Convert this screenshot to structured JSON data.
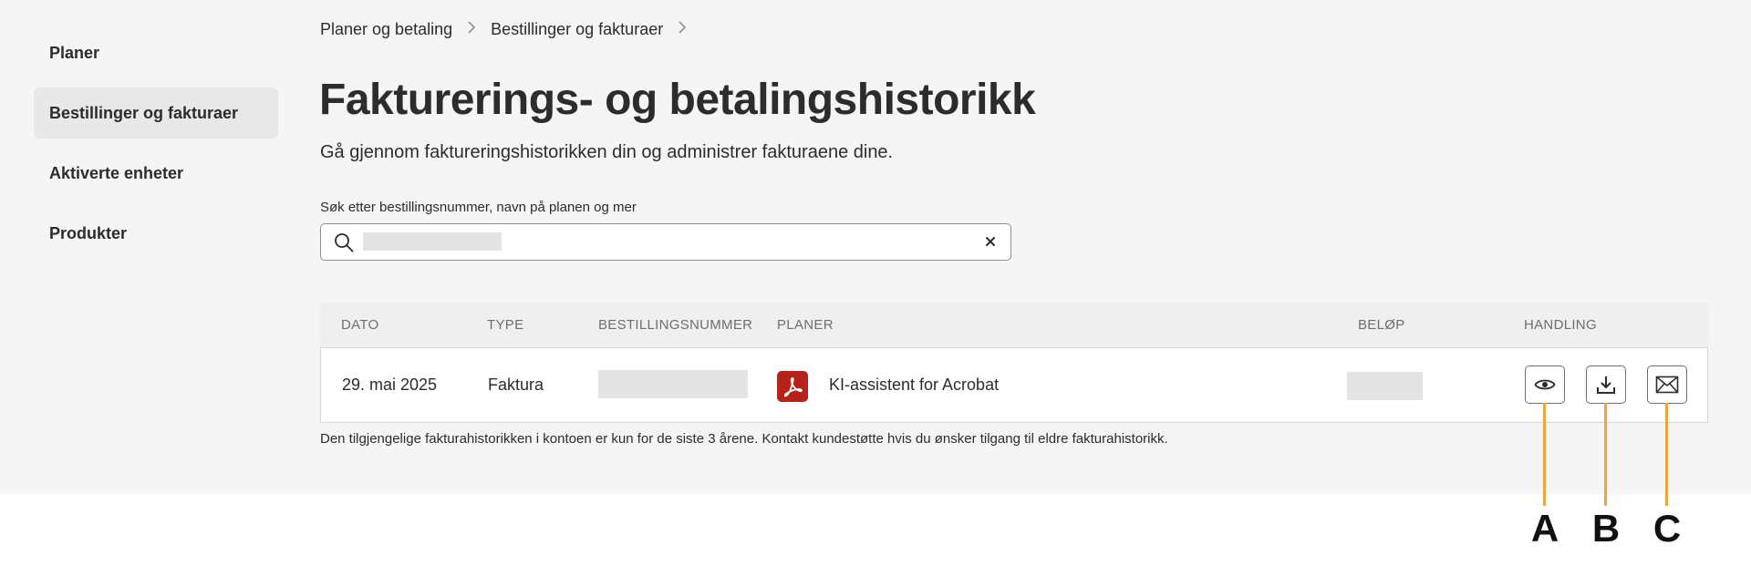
{
  "sidebar": {
    "items": [
      {
        "label": "Planer"
      },
      {
        "label": "Bestillinger og fakturaer"
      },
      {
        "label": "Aktiverte enheter"
      },
      {
        "label": "Produkter"
      }
    ]
  },
  "breadcrumb": {
    "items": [
      "Planer og betaling",
      "Bestillinger og fakturaer"
    ],
    "separator": ">"
  },
  "page": {
    "title": "Fakturerings- og betalingshistorikk",
    "subtitle": "Gå gjennom faktureringshistorikken din og administrer fakturaene dine."
  },
  "search": {
    "label": "Søk etter bestillingsnummer, navn på planen og mer",
    "value": "",
    "clear_icon": "close-icon"
  },
  "table": {
    "headers": {
      "date": "DATO",
      "type": "TYPE",
      "order_number": "BESTILLINGSNUMMER",
      "plans": "PLANER",
      "amount": "BELØP",
      "action": "HANDLING"
    },
    "rows": [
      {
        "date": "29. mai 2025",
        "type": "Faktura",
        "order_number": "",
        "plan": "KI-assistent for Acrobat",
        "plan_icon": "acrobat-pdf-icon",
        "amount": "",
        "actions": [
          "view-eye-icon",
          "download-icon",
          "email-icon"
        ]
      }
    ]
  },
  "footnote": "Den tilgjengelige fakturahistorikken i kontoen er kun for de siste 3 årene. Kontakt kundestøtte hvis du ønsker tilgang til eldre fakturahistorikk.",
  "callouts": [
    "A",
    "B",
    "C"
  ],
  "colors": {
    "panel_bg": "#f5f5f5",
    "acrobat_red": "#b6231b",
    "callout_orange": "#f0a43a"
  }
}
